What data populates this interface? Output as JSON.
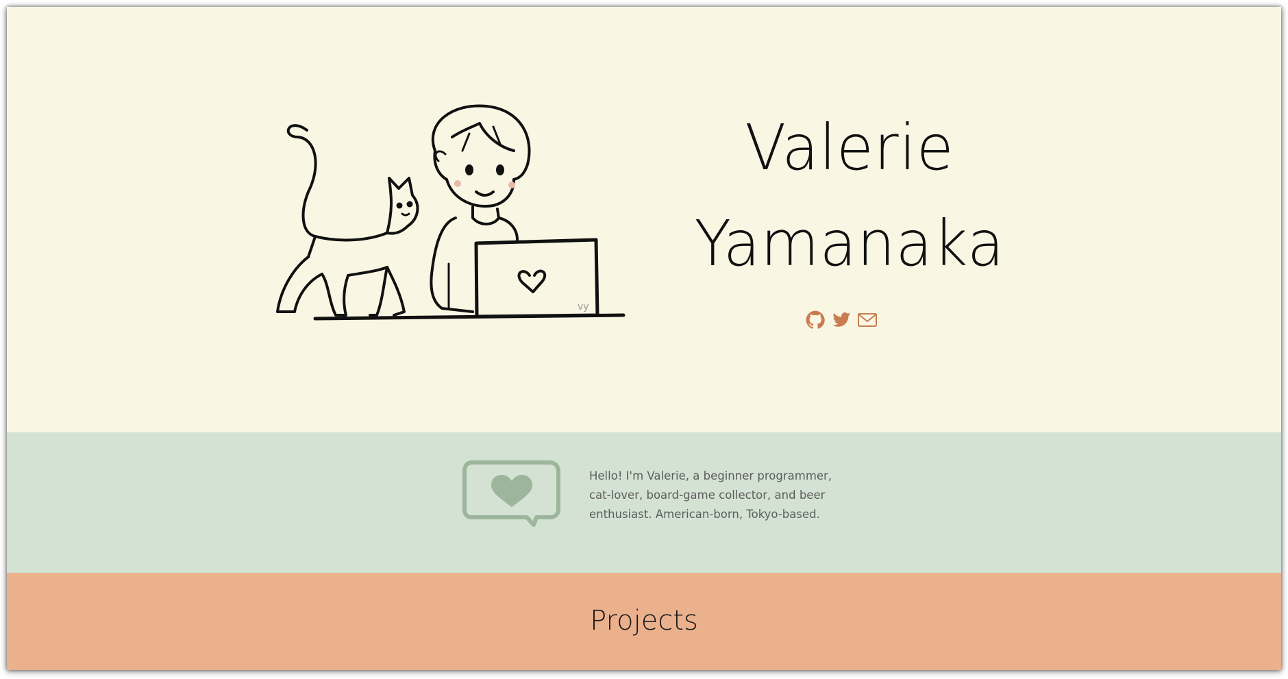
{
  "hero": {
    "first_name": "Valerie",
    "last_name": "Yamanaka",
    "illustration_signature": "vy",
    "social_links": [
      {
        "icon": "github-icon",
        "label": "GitHub"
      },
      {
        "icon": "twitter-icon",
        "label": "Twitter"
      },
      {
        "icon": "mail-icon",
        "label": "Email"
      }
    ],
    "accent_color": "#c87c50"
  },
  "about": {
    "text": "Hello! I'm Valerie, a beginner programmer, cat-lover, board-game collector, and beer enthusiast. American-born, Tokyo-based.",
    "icon": "heart-speech-bubble-icon"
  },
  "projects": {
    "title": "Projects"
  },
  "colors": {
    "hero_bg": "#faf6e4",
    "about_bg": "#d3e2d3",
    "projects_bg": "#ebb08c",
    "bubble_color": "#9db59c"
  }
}
